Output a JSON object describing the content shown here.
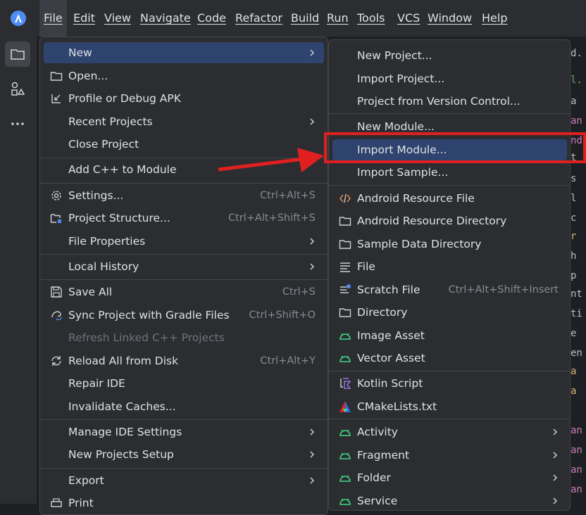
{
  "menubar": {
    "items": [
      "File",
      "Edit",
      "View",
      "Navigate",
      "Code",
      "Refactor",
      "Build",
      "Run",
      "Tools",
      "VCS",
      "Window",
      "Help"
    ]
  },
  "file_menu": {
    "items": [
      {
        "label": "New",
        "has_submenu": true
      },
      {
        "label": "Open...",
        "icon": "folder-icon"
      },
      {
        "label": "Profile or Debug APK",
        "icon": "profile-apk-icon"
      },
      {
        "label": "Recent Projects",
        "has_submenu": true
      },
      {
        "label": "Close Project"
      },
      {
        "label": "Add C++ to Module"
      },
      {
        "label": "Settings...",
        "shortcut": "Ctrl+Alt+S",
        "icon": "gear-icon"
      },
      {
        "label": "Project Structure...",
        "shortcut": "Ctrl+Alt+Shift+S",
        "icon": "project-structure-icon"
      },
      {
        "label": "File Properties",
        "has_submenu": true
      },
      {
        "label": "Local History",
        "has_submenu": true
      },
      {
        "label": "Save All",
        "shortcut": "Ctrl+S",
        "icon": "save-icon"
      },
      {
        "label": "Sync Project with Gradle Files",
        "shortcut": "Ctrl+Shift+O",
        "icon": "gradle-sync-icon"
      },
      {
        "label": "Refresh Linked C++ Projects",
        "disabled": true
      },
      {
        "label": "Reload All from Disk",
        "shortcut": "Ctrl+Alt+Y",
        "icon": "reload-icon"
      },
      {
        "label": "Repair IDE"
      },
      {
        "label": "Invalidate Caches..."
      },
      {
        "label": "Manage IDE Settings",
        "has_submenu": true
      },
      {
        "label": "New Projects Setup",
        "has_submenu": true
      },
      {
        "label": "Export",
        "has_submenu": true
      },
      {
        "label": "Print",
        "icon": "print-icon"
      }
    ]
  },
  "new_submenu": {
    "items": [
      {
        "label": "New Project..."
      },
      {
        "label": "Import Project..."
      },
      {
        "label": "Project from Version Control..."
      },
      {
        "label": "New Module..."
      },
      {
        "label": "Import Module..."
      },
      {
        "label": "Import Sample..."
      },
      {
        "label": "Android Resource File",
        "icon": "code-file-icon"
      },
      {
        "label": "Android Resource Directory",
        "icon": "folder-icon"
      },
      {
        "label": "Sample Data Directory",
        "icon": "folder-icon"
      },
      {
        "label": "File",
        "icon": "file-lines-icon"
      },
      {
        "label": "Scratch File",
        "shortcut": "Ctrl+Alt+Shift+Insert",
        "icon": "scratch-file-icon"
      },
      {
        "label": "Directory",
        "icon": "folder-icon"
      },
      {
        "label": "Image Asset",
        "icon": "android-icon"
      },
      {
        "label": "Vector Asset",
        "icon": "android-icon"
      },
      {
        "label": "Kotlin Script",
        "icon": "kotlin-script-icon"
      },
      {
        "label": "CMakeLists.txt",
        "icon": "cmake-icon"
      },
      {
        "label": "Activity",
        "icon": "android-icon",
        "has_submenu": true
      },
      {
        "label": "Fragment",
        "icon": "android-icon",
        "has_submenu": true
      },
      {
        "label": "Folder",
        "icon": "android-icon",
        "has_submenu": true
      },
      {
        "label": "Service",
        "icon": "android-icon",
        "has_submenu": true
      }
    ]
  },
  "editor": {
    "fragments": [
      "d.",
      "l.",
      "a",
      "an",
      "nd",
      "t",
      "s",
      "l",
      "c",
      "r",
      "h",
      "p",
      "nt",
      "ti",
      "e",
      "en",
      "a",
      "a",
      "an",
      "an",
      "an",
      "an"
    ]
  },
  "colors": {
    "highlight": "#2e436e",
    "annotation_red": "#e02020",
    "android_green": "#3ddc84"
  }
}
